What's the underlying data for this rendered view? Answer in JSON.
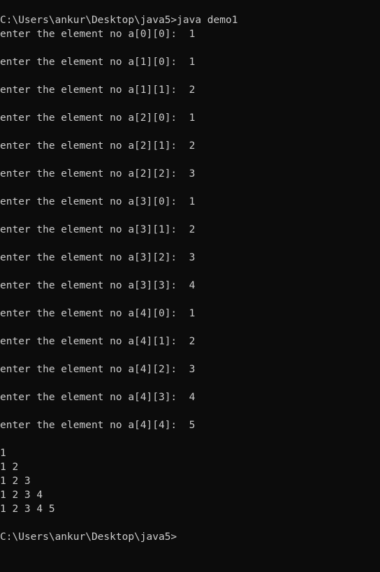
{
  "terminal": {
    "lines": [
      "C:\\Users\\ankur\\Desktop\\java5>java demo1",
      "enter the element no a[0][0]:  1",
      "",
      "enter the element no a[1][0]:  1",
      "",
      "enter the element no a[1][1]:  2",
      "",
      "enter the element no a[2][0]:  1",
      "",
      "enter the element no a[2][1]:  2",
      "",
      "enter the element no a[2][2]:  3",
      "",
      "enter the element no a[3][0]:  1",
      "",
      "enter the element no a[3][1]:  2",
      "",
      "enter the element no a[3][2]:  3",
      "",
      "enter the element no a[3][3]:  4",
      "",
      "enter the element no a[4][0]:  1",
      "",
      "enter the element no a[4][1]:  2",
      "",
      "enter the element no a[4][2]:  3",
      "",
      "enter the element no a[4][3]:  4",
      "",
      "enter the element no a[4][4]:  5",
      "",
      "1",
      "1 2",
      "1 2 3",
      "1 2 3 4",
      "1 2 3 4 5",
      "",
      "C:\\Users\\ankur\\Desktop\\java5>"
    ]
  },
  "colors": {
    "background": "#0c0c0c",
    "text": "#cccccc"
  }
}
